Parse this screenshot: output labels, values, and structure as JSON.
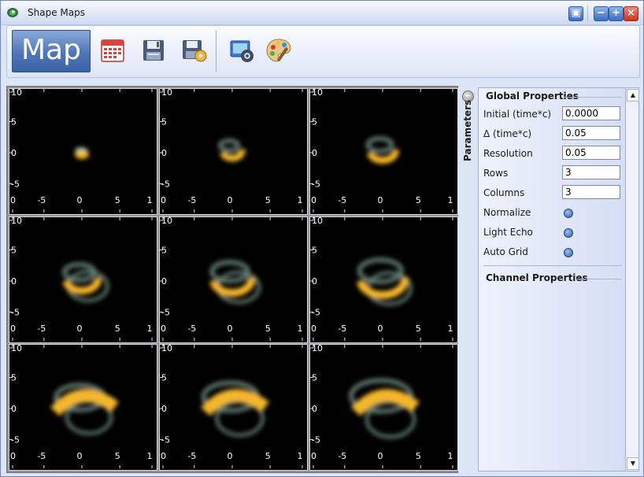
{
  "window": {
    "title": "Shape Maps",
    "controls": {
      "lock": "▣",
      "minimize": "−",
      "maximize": "+",
      "close": "×"
    }
  },
  "toolbar": {
    "map_label": "Map",
    "icons": [
      "calendar-icon",
      "save-icon",
      "save-settings-icon",
      "render-settings-icon",
      "palette-icon"
    ]
  },
  "maps": {
    "tick_labels": {
      "y": [
        "10",
        "5",
        "0",
        "-5"
      ],
      "x": [
        "0",
        "-5",
        "0",
        "5",
        "1"
      ]
    },
    "colors": {
      "gold": "#f4b72a",
      "teal": "#6f8f82",
      "background": "#000000"
    }
  },
  "parameters_tab": {
    "label": "Parameters",
    "toggle": "−"
  },
  "global_properties": {
    "title": "Global Properties",
    "fields": [
      {
        "label": "Initial (time*c)",
        "value": "0.0000"
      },
      {
        "label": "Δ (time*c)",
        "value": "0.05"
      },
      {
        "label": "Resolution",
        "value": "0.05"
      },
      {
        "label": "Rows",
        "value": "3"
      },
      {
        "label": "Columns",
        "value": "3"
      }
    ],
    "options": [
      {
        "label": "Normalize"
      },
      {
        "label": "Light Echo"
      },
      {
        "label": "Auto Grid"
      }
    ]
  },
  "channel_properties": {
    "title": "Channel Properties"
  },
  "scrollbar": {
    "up": "▲",
    "down": "▼"
  }
}
